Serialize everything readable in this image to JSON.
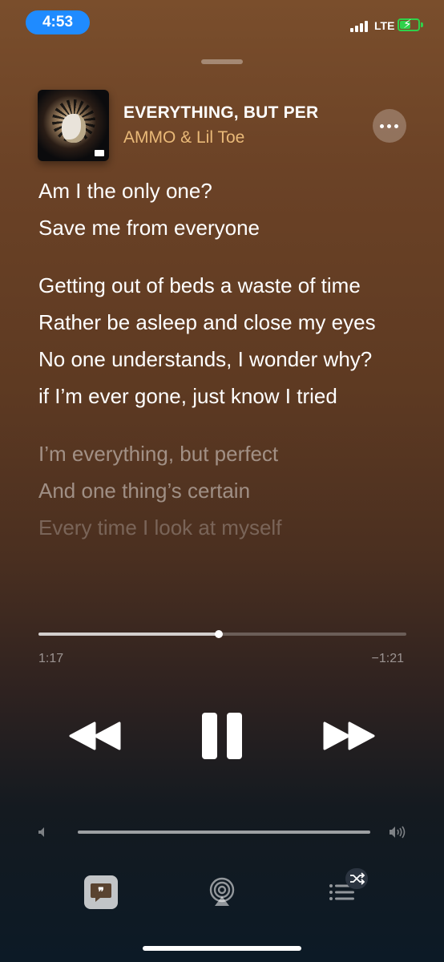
{
  "status_bar": {
    "time": "4:53",
    "network": "LTE"
  },
  "now_playing": {
    "title": "EVERYTHING, BUT PER",
    "artist": "AMMO & Lil Toe"
  },
  "lyrics": {
    "active_lines": [
      "Am I the only one?",
      "Save me from everyone",
      "Getting out of beds a waste of time",
      "Rather be asleep and close my eyes",
      "No one understands, I wonder why?",
      "if I’m ever gone, just know I tried"
    ],
    "upcoming_lines": [
      "I’m everything, but perfect",
      "And one thing’s certain",
      "Every time I look at myself"
    ]
  },
  "playback": {
    "elapsed": "1:17",
    "remaining": "−1:21",
    "progress_fraction": 0.49
  },
  "volume": {
    "level_fraction": 0.999
  },
  "icons": {
    "more": "ellipsis-icon",
    "rewind": "rewind-icon",
    "pause": "pause-icon",
    "forward": "fast-forward-icon",
    "volume_low": "speaker-low-icon",
    "volume_high": "speaker-high-icon",
    "lyrics": "lyrics-quote-icon",
    "airplay": "airplay-icon",
    "queue": "queue-list-icon",
    "shuffle": "shuffle-icon"
  },
  "colors": {
    "accent_artist": "#e9b978",
    "time_pill": "#1f8bff",
    "battery": "#2fd14a"
  }
}
